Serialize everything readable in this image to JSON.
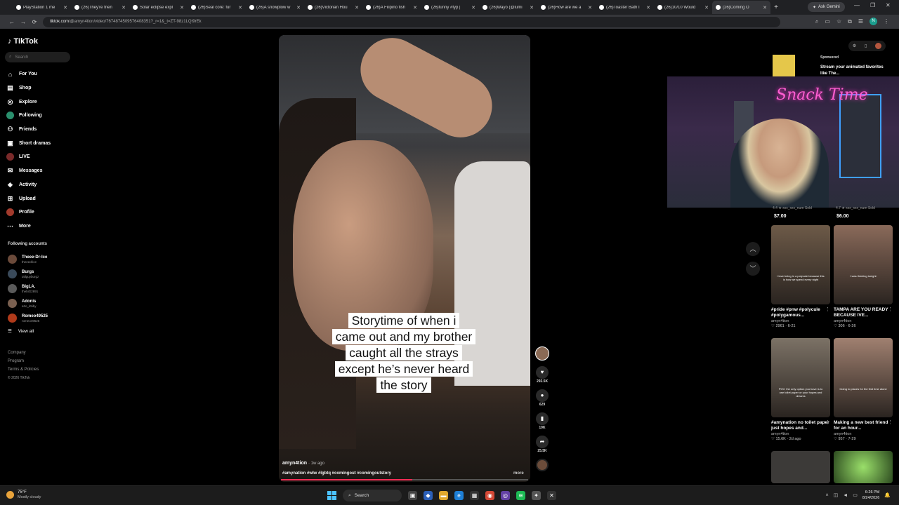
{
  "browser": {
    "tabs": [
      {
        "title": "PlayStation 1 me",
        "active": false
      },
      {
        "title": "(26)They're frien",
        "active": false
      },
      {
        "title": "Solar eclipse expl",
        "active": false
      },
      {
        "title": "(26)Seal core: fur",
        "active": false
      },
      {
        "title": "(26)A snowplow w",
        "active": false
      },
      {
        "title": "(26)Victorian Hou",
        "active": false
      },
      {
        "title": "(26)A Filipino fish",
        "active": false
      },
      {
        "title": "(26)funny #fyp |",
        "active": false
      },
      {
        "title": "(26)Wayo (@lumi",
        "active": false
      },
      {
        "title": "(26)How are we a",
        "active": false
      },
      {
        "title": "(26)Toaster Bath I",
        "active": false
      },
      {
        "title": "(26)10/10 Would",
        "active": false
      },
      {
        "title": "(26)Coming O",
        "active": true
      }
    ],
    "new_tab_icon": "+",
    "ask_gemini_label": "Ask Gemini",
    "url_host": "tiktok.com",
    "url_path": "/@amyn4tion/video/7674874509576408351?_r=1&_t=ZT-98z1LQt9rEk",
    "profile_initial": "N"
  },
  "sidebar": {
    "logo_text": "TikTok",
    "search_placeholder": "Search",
    "nav": [
      {
        "label": "For You",
        "icon": "home-icon"
      },
      {
        "label": "Shop",
        "icon": "shop-icon"
      },
      {
        "label": "Explore",
        "icon": "compass-icon"
      },
      {
        "label": "Following",
        "icon": "following-avatar-icon"
      },
      {
        "label": "Friends",
        "icon": "friends-icon"
      },
      {
        "label": "Short dramas",
        "icon": "drama-icon"
      },
      {
        "label": "LIVE",
        "icon": "live-icon"
      },
      {
        "label": "Messages",
        "icon": "messages-icon"
      },
      {
        "label": "Activity",
        "icon": "activity-icon"
      },
      {
        "label": "Upload",
        "icon": "upload-icon"
      },
      {
        "label": "Profile",
        "icon": "profile-icon"
      },
      {
        "label": "More",
        "icon": "more-icon"
      }
    ],
    "following_title": "Following accounts",
    "following": [
      {
        "name": "Theee-Dr-Ice",
        "handle": "theeedrice"
      },
      {
        "name": "Burgs",
        "handle": "tallguyburgz"
      },
      {
        "name": "BigLA.",
        "handle": "thebiG2891"
      },
      {
        "name": "Adonis",
        "handle": "a3o_k5iby"
      },
      {
        "name": "Romeo49525",
        "handle": "romeo49525"
      }
    ],
    "view_all": "View all",
    "footer": [
      "Company",
      "Program",
      "Terms & Policies"
    ],
    "copyright": "© 2026 TikTok"
  },
  "video": {
    "caption_lines": [
      "Storytime of when i",
      "came out and my brother",
      "caught all the strays",
      "except he’s never heard",
      "the story"
    ],
    "author": "amyn4tion",
    "posted": "· 1w ago",
    "hashtags": "#amynation #wlw #lgbtq #comingout #comingoutstory",
    "more_label": "more",
    "progress": 0.53
  },
  "actions": {
    "likes": "292.5K",
    "comments": "629",
    "saves": "19K",
    "shares": "25.5K"
  },
  "right_panel": {
    "sponsored_label": "Sponsored",
    "sponsored_text": "Stream your animated favorites like The...",
    "price_sub_1": "4.4 ★  xxx_xxx_num Sold",
    "price_sub_2": "4.7 ★  xxx_xxx_num Sold",
    "price_1": "$7.00",
    "price_2": "$6.00",
    "webcam_sign": "Snack Time",
    "cards": [
      {
        "title": "#pride #pnw #polycule #polygamous...",
        "author": "amyn4tion",
        "meta": "♡ 2961 · 6-21",
        "thumb_text": "I love being in a polycule because this is how we spend every night",
        "color": "#6d5a48"
      },
      {
        "title": "TAMPA ARE YOU READY BECAUSE IVE...",
        "author": "amyn4tion",
        "meta": "♡ 306 · 6-26",
        "thumb_text": "I was thinking tonight",
        "color": "#8a6a5a"
      },
      {
        "title": "#amynation no toilet paper just hopes and...",
        "author": "amyn4tion",
        "meta": "♡ 15.6K · 2d ago",
        "thumb_text": "POV: the only option you have is to use toilet paper or your hopes and dreams",
        "color": "#7c7266"
      },
      {
        "title": "Making a new best friend for an hour...",
        "author": "amyn4tion",
        "meta": "♡ 957 · 7-29",
        "thumb_text": "Going to places for the first time alone",
        "color": "#a08070"
      }
    ]
  },
  "taskbar": {
    "temperature": "75°F",
    "weather": "Mostly cloudy",
    "search_label": "Search",
    "time": "6:26 PM",
    "date": "8/24/2026"
  }
}
